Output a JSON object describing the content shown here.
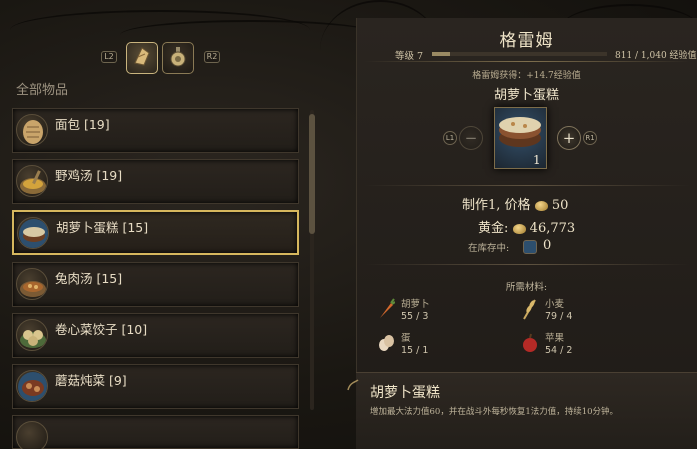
{
  "left_panel": {
    "shoulder_left": "L2",
    "shoulder_right": "R2",
    "category_tabs": [
      {
        "icon": "bread-icon",
        "active": true
      },
      {
        "icon": "potion-icon",
        "active": false
      }
    ],
    "list_title": "全部物品",
    "items": [
      {
        "label": "面包 [19]",
        "icon": "bread-icon",
        "selected": false
      },
      {
        "label": "野鸡汤 [19]",
        "icon": "soup-icon",
        "selected": false
      },
      {
        "label": "胡萝卜蛋糕 [15]",
        "icon": "cake-icon",
        "selected": true
      },
      {
        "label": "兔肉汤 [15]",
        "icon": "stew-icon",
        "selected": false
      },
      {
        "label": "卷心菜饺子 [10]",
        "icon": "dumpling-icon",
        "selected": false
      },
      {
        "label": "蘑菇炖菜 [9]",
        "icon": "mushroom-stew-icon",
        "selected": false
      },
      {
        "label": "",
        "icon": "partial-item-icon",
        "selected": false
      }
    ]
  },
  "merchant": {
    "name": "格雷姆",
    "level_label": "等级 7",
    "xp_fraction": 0.1,
    "xp_text": "811 / 1,040 经验值",
    "gain_text": "格雷姆获得：+14.7经验值"
  },
  "product": {
    "title": "胡萝卜蛋糕",
    "quantity": "1",
    "minus_label": "−",
    "plus_label": "+",
    "side_left": "L1",
    "side_right": "R1",
    "craft_text": "制作1, 价格",
    "craft_price": "50",
    "gold_label": "黄金:",
    "gold_value": "46,773",
    "stock_label": "在库存中:",
    "stock_value": "0"
  },
  "materials": {
    "title": "所需材料:",
    "list": [
      {
        "name": "胡萝卜",
        "count": "55 / 3",
        "icon": "carrot-icon",
        "color": "#c8642c"
      },
      {
        "name": "小麦",
        "count": "79 / 4",
        "icon": "wheat-icon",
        "color": "#c9a860"
      },
      {
        "name": "蛋",
        "count": "15 / 1",
        "icon": "egg-icon",
        "color": "#e8d7c0"
      },
      {
        "name": "苹果",
        "count": "54 / 2",
        "icon": "apple-icon",
        "color": "#b42a26"
      }
    ]
  },
  "description": {
    "title": "胡萝卜蛋糕",
    "text": "增加最大法力值60，并在战斗外每秒恢复1法力值，持续10分钟。"
  },
  "colors": {
    "accent_gold": "#d6b75e",
    "panel": "#2a2520",
    "text": "#e7dcc4"
  }
}
